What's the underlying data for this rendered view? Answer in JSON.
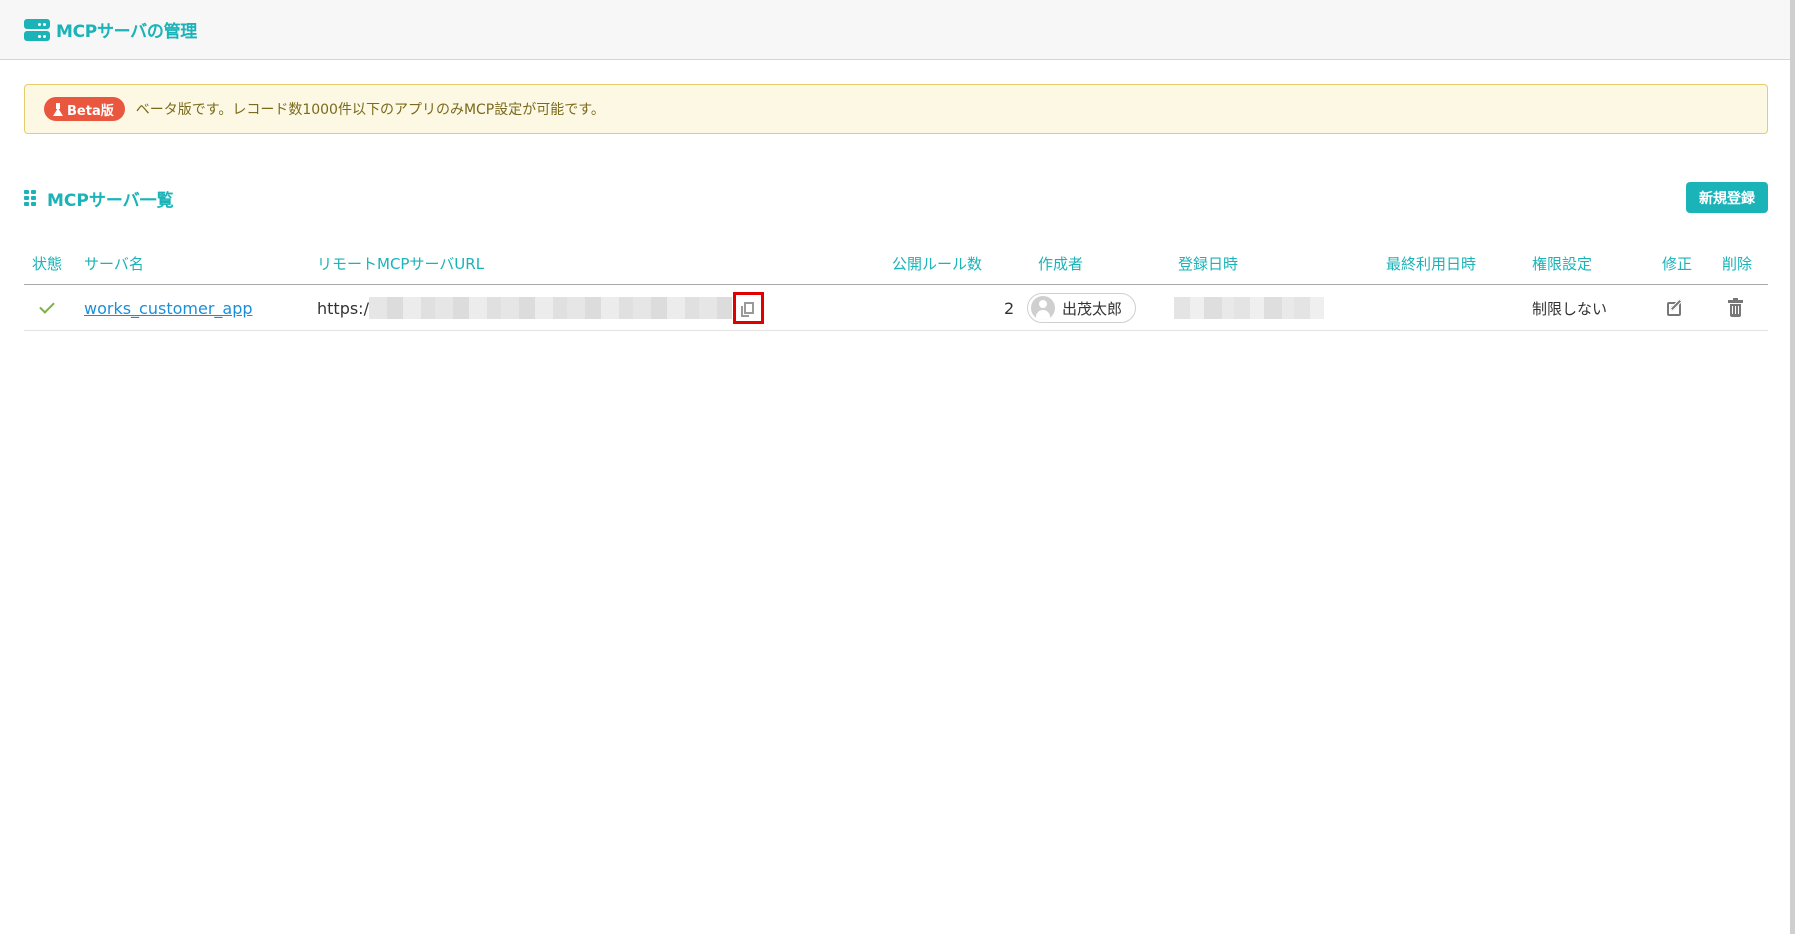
{
  "header": {
    "title": "MCPサーバの管理",
    "icon": "server-icon"
  },
  "beta": {
    "badge": "Beta版",
    "message": "ベータ版です。レコード数1000件以下のアプリのみMCP設定が可能です。",
    "badge_color": "#e9573f"
  },
  "section": {
    "title": "MCPサーバ一覧",
    "new_button": "新規登録"
  },
  "table": {
    "columns": [
      "状態",
      "サーバ名",
      "リモートMCPサーバURL",
      "公開ルール数",
      "作成者",
      "登録日時",
      "最終利用日時",
      "権限設定",
      "修正",
      "削除"
    ],
    "rows": [
      {
        "status": "active",
        "name": "works_customer_app",
        "url_prefix": "https:/",
        "rules": "2",
        "author": "出茂太郎",
        "registered": "",
        "last_used": "",
        "permission": "制限しない"
      }
    ]
  },
  "colors": {
    "accent": "#1ab3b8",
    "link": "#1a8fd8",
    "highlight": "#e00000"
  }
}
